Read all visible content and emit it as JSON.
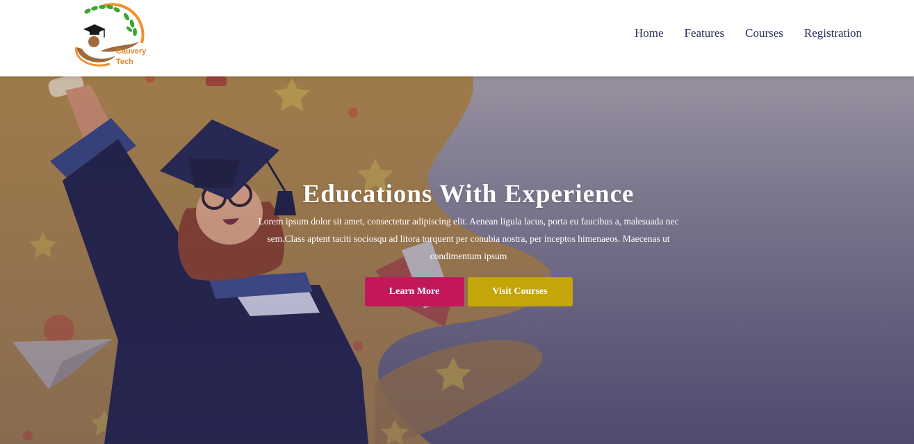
{
  "brand": {
    "line1": "Cauvery",
    "line2": "Tech",
    "colors": {
      "leaf": "#3fa535",
      "arc": "#f0912f",
      "swoosh": "#a06a3c"
    }
  },
  "nav": {
    "items": [
      {
        "label": "Home"
      },
      {
        "label": "Features"
      },
      {
        "label": "Courses"
      },
      {
        "label": "Registration"
      }
    ]
  },
  "hero": {
    "title": "Educations With Experience",
    "description": "Lorem ipsum dolor sit amet, consectetur adipiscing elit. Aenean ligula lacus, porta eu faucibus a, malesuada nec sem.Class aptent taciti sociosqu ad litora torquent per conubia nostra, per inceptos himenaeos. Maecenas ut condimentum ipsum",
    "buttons": {
      "learn_more": "Learn More",
      "visit_courses": "Visit Courses"
    },
    "colors": {
      "learn_more": "#c2185b",
      "visit_courses": "#c4a60a"
    }
  }
}
